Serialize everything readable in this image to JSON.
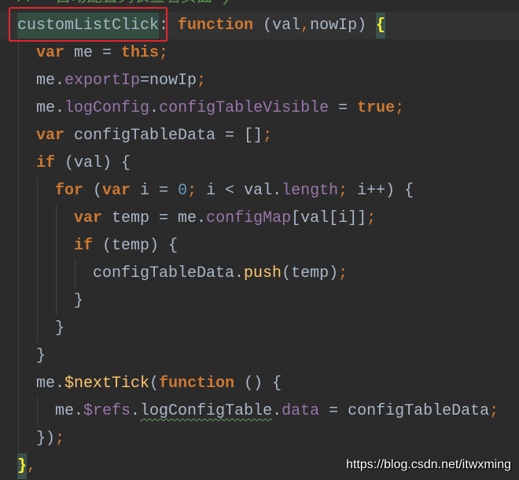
{
  "editor": {
    "colors": {
      "background": "#2B2B2B",
      "text": "#A9B7C6",
      "keyword": "#CC7832",
      "field": "#9876AA",
      "method": "#FFC66D",
      "number": "#6897BB",
      "comment": "#629755",
      "caret_row": "#323232",
      "usage_highlight": "#344D41",
      "brace_match_bg": "#3B514D",
      "brace_match_fg": "#FFEF28",
      "typo_underline": "#659C6B",
      "indent_guide": "#444444",
      "annotation_box": "#E3262B",
      "watermark_text": "#FFFFFF"
    },
    "lines": [
      [
        "//  自动配置列表查看页面 )"
      ],
      [
        "customListClick",
        ": ",
        "function",
        " (val",
        ",",
        "nowIp) ",
        "{"
      ],
      [
        "  var",
        " me = ",
        "this",
        ";"
      ],
      [
        "  me.",
        "exportIp",
        "=nowIp",
        ";"
      ],
      [
        "  me.",
        "logConfig",
        ".",
        "configTableVisible",
        " = ",
        "true",
        ";"
      ],
      [
        "  var",
        " configTableData = []",
        ";"
      ],
      [
        "  if",
        " (val) {"
      ],
      [
        "    for",
        " (",
        "var",
        " i = ",
        "0",
        ";",
        " i < val.",
        "length",
        ";",
        " i++) {"
      ],
      [
        "      var",
        " temp = me.",
        "configMap",
        "[val[i]]",
        ";"
      ],
      [
        "      if",
        " (temp) {"
      ],
      [
        "        configTableData.",
        "push",
        "(temp)",
        ";"
      ],
      [
        "      }"
      ],
      [
        "    }"
      ],
      [
        "  }"
      ],
      [
        "  me.",
        "$nextTick",
        "(",
        "function",
        " () {"
      ],
      [
        "    me.",
        "$refs",
        ".",
        "logConfigTable",
        ".",
        "data",
        " = configTableData",
        ";"
      ],
      [
        "  })",
        ";"
      ],
      [
        "}",
        ","
      ]
    ]
  },
  "watermark": "https://blog.csdn.net/itwxming"
}
